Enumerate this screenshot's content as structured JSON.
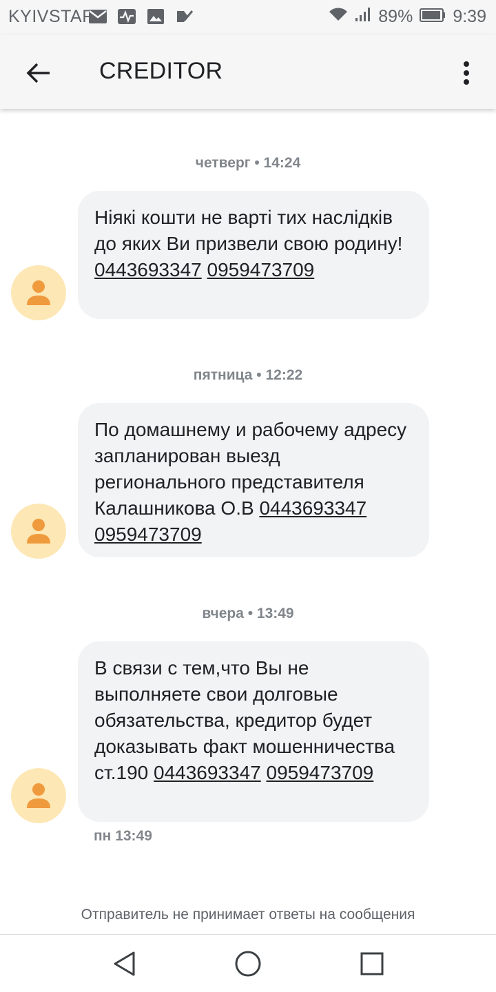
{
  "status_bar": {
    "carrier": "KYIVSTAR",
    "battery": "89%",
    "time": "9:39",
    "icons_left": [
      "mail-icon",
      "pulse-icon",
      "image-icon",
      "check-list-icon"
    ],
    "icons_right": [
      "wifi-icon",
      "signal-icon",
      "battery-icon"
    ]
  },
  "app_bar": {
    "title": "CREDITOR",
    "back_icon": "arrow-left-icon",
    "menu_icon": "more-vert-icon"
  },
  "messages": [
    {
      "day": "четверг • 14:24",
      "text": "Ніякі кошти не варті тих наслідків до яких Ви призвели свою родину!",
      "phone1": "0443693347",
      "phone2": "0959473709"
    },
    {
      "day": "пятница • 12:22",
      "text": "По домашнему и рабочему адресу запланирован выезд регионального представителя Калашникова О.В",
      "phone1": "0443693347",
      "phone2": "0959473709"
    },
    {
      "day": "вчера • 13:49",
      "text": "В связи с тем,что Вы не выполняете свои долговые обязательства, кредитор будет доказывать факт мошенничества ст.190",
      "phone1": "0443693347",
      "phone2": "0959473709",
      "time": "пн 13:49"
    }
  ],
  "footer_note": "Отправитель не принимает ответы на сообщения",
  "colors": {
    "bubble": "#f1f3f4",
    "avatar_bg": "#fde7b4",
    "avatar_fg": "#f09a3e",
    "bar_bg": "#f6f6f6"
  }
}
